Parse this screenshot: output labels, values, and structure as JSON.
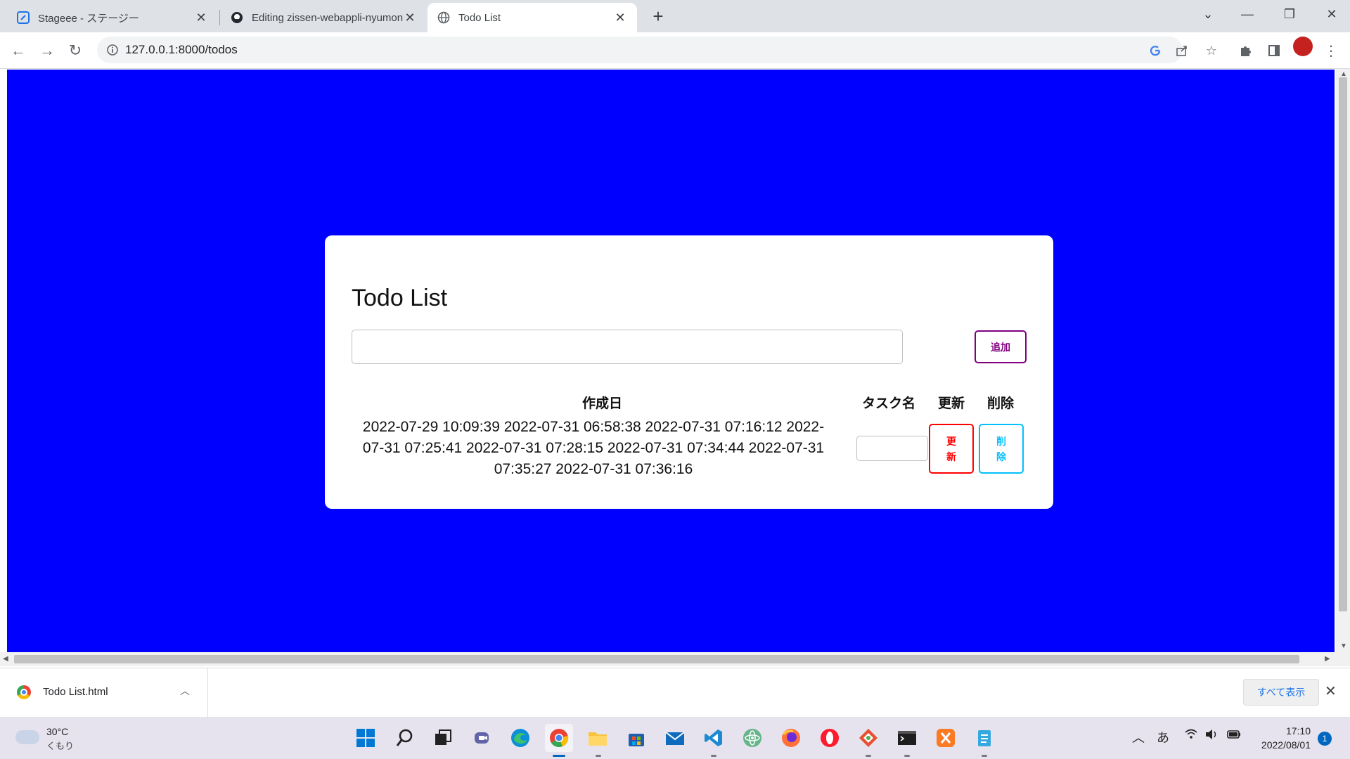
{
  "browser": {
    "tabs": [
      {
        "title": "Stageee - ステージー",
        "active": false
      },
      {
        "title": "Editing zissen-webappli-nyumon",
        "active": false
      },
      {
        "title": "Todo List",
        "active": true
      }
    ],
    "url": "127.0.0.1:8000/todos"
  },
  "page": {
    "background_color": "#0000ff",
    "title": "Todo List",
    "new_task_placeholder": "",
    "add_button_label": "追加",
    "columns": {
      "created": "作成日",
      "task_name": "タスク名",
      "update": "更新",
      "delete": "削除"
    },
    "created_dates_text": "2022-07-29 10:09:39 2022-07-31 06:58:38 2022-07-31 07:16:12 2022-07-31 07:25:41 2022-07-31 07:28:15 2022-07-31 07:34:44 2022-07-31 07:35:27 2022-07-31 07:36:16",
    "task_name_value": "",
    "update_button_label": "更新",
    "delete_button_label": "削除",
    "colors": {
      "add_button": "#800080",
      "update_button": "#ff0000",
      "delete_button": "#00bfff"
    }
  },
  "downloads": {
    "file_name": "Todo List.html",
    "show_all_label": "すべて表示"
  },
  "taskbar": {
    "weather_temp": "30°C",
    "weather_condition": "くもり",
    "ime_indicator": "あ",
    "time": "17:10",
    "date": "2022/08/01",
    "notification_count": "1"
  }
}
